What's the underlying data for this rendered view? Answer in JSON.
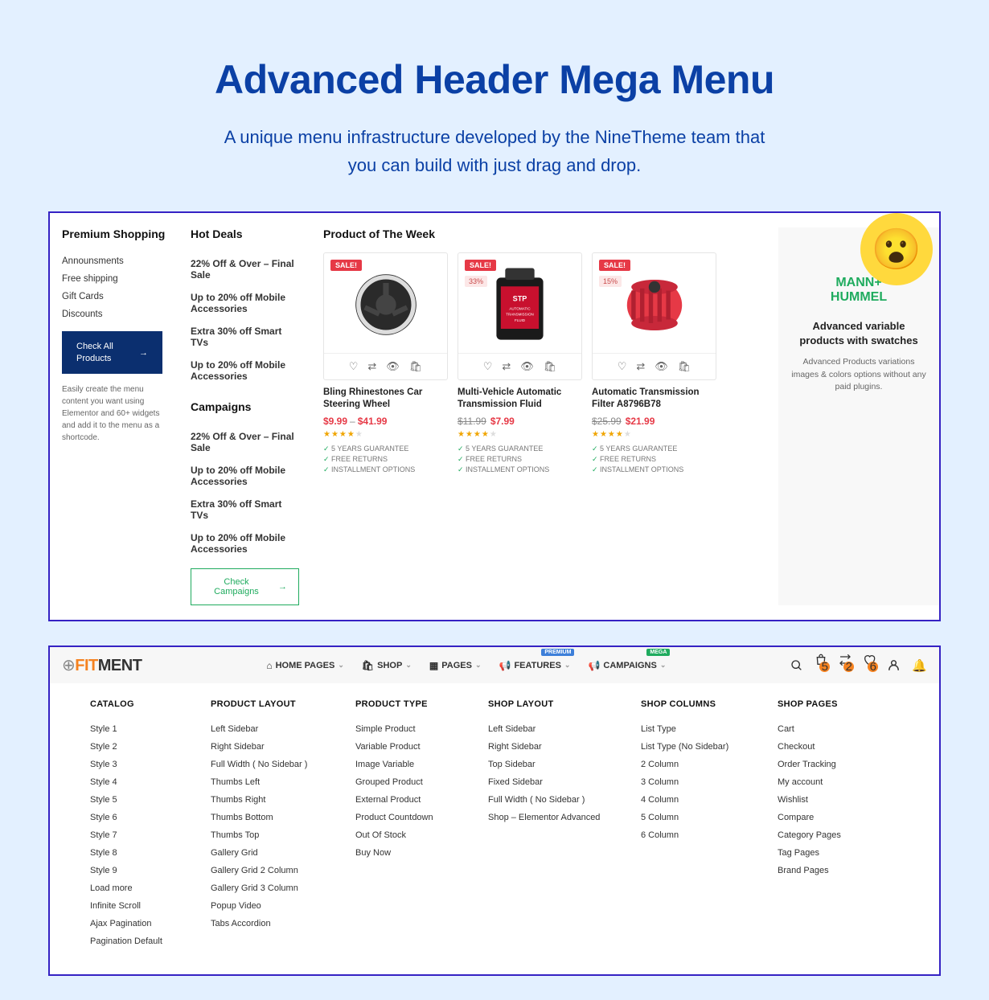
{
  "hero": {
    "title": "Advanced Header Mega Menu",
    "subtitle": "A unique menu infrastructure developed by the NineTheme team that you can build with just drag and drop."
  },
  "panel1": {
    "premium": {
      "heading": "Premium Shopping",
      "items": [
        "Announsments",
        "Free shipping",
        "Gift Cards",
        "Discounts"
      ],
      "button": "Check All Products",
      "helper": "Easily create the menu content you want using Elementor and 60+ widgets and add it to the menu as a shortcode."
    },
    "deals": {
      "heading": "Hot Deals",
      "items": [
        "22% Off & Over – Final Sale",
        "Up to 20% off Mobile Accessories",
        "Extra 30% off Smart TVs",
        "Up to 20% off Mobile Accessories"
      ],
      "campaigns_heading": "Campaigns",
      "campaign_items": [
        "22% Off & Over – Final Sale",
        "Up to 20% off Mobile Accessories",
        "Extra 30% off Smart TVs",
        "Up to 20% off Mobile Accessories"
      ],
      "button": "Check Campaigns"
    },
    "products_heading": "Product of The Week",
    "products": [
      {
        "sale": "SALE!",
        "pct": "",
        "title": "Bling Rhinestones Car Steering Wheel",
        "price_from": "$9.99",
        "price_to": "$41.99",
        "dash": true,
        "features": [
          "5 YEARS GUARANTEE",
          "FREE RETURNS",
          "INSTALLMENT OPTIONS"
        ]
      },
      {
        "sale": "SALE!",
        "pct": "33%",
        "title": "Multi-Vehicle Automatic Transmission Fluid",
        "price_old": "$11.99",
        "price_new": "$7.99",
        "features": [
          "5 YEARS GUARANTEE",
          "FREE RETURNS",
          "INSTALLMENT OPTIONS"
        ]
      },
      {
        "sale": "SALE!",
        "pct": "15%",
        "title": "Automatic Transmission Filter A8796B78",
        "price_old": "$25.99",
        "price_new": "$21.99",
        "features": [
          "5 YEARS GUARANTEE",
          "FREE RETURNS",
          "INSTALLMENT OPTIONS"
        ]
      }
    ],
    "brand": {
      "logo1": "MANN+",
      "logo2": "HUMMEL",
      "heading": "Advanced variable products with swatches",
      "desc": "Advanced Products variations images & colors options without any paid plugins."
    }
  },
  "panel2": {
    "logo_fit": "FIT",
    "logo_ment": "MENT",
    "nav": [
      {
        "label": "HOME PAGES",
        "tag": ""
      },
      {
        "label": "SHOP",
        "tag": ""
      },
      {
        "label": "PAGES",
        "tag": ""
      },
      {
        "label": "FEATURES",
        "tag": "PREMIUM"
      },
      {
        "label": "CAMPAIGNS",
        "tag": "MEGA"
      }
    ],
    "badges": {
      "bag": "5",
      "compare": "2",
      "heart": "6"
    },
    "cols": [
      {
        "heading": "CATALOG",
        "items": [
          "Style 1",
          "Style 2",
          "Style 3",
          "Style 4",
          "Style 5",
          "Style 6",
          "Style 7",
          "Style 8",
          "Style 9",
          "Load more",
          "Infinite Scroll",
          "Ajax Pagination",
          "Pagination Default"
        ]
      },
      {
        "heading": "PRODUCT LAYOUT",
        "items": [
          "Left Sidebar",
          "Right Sidebar",
          "Full Width ( No Sidebar )",
          "Thumbs Left",
          "Thumbs Right",
          "Thumbs Bottom",
          "Thumbs Top",
          "Gallery Grid",
          "Gallery Grid 2 Column",
          "Gallery Grid 3 Column",
          "Popup Video",
          "Tabs Accordion"
        ]
      },
      {
        "heading": "PRODUCT TYPE",
        "items": [
          "Simple Product",
          "Variable Product",
          "Image Variable",
          "Grouped Product",
          "External Product",
          "Product Countdown",
          "Out Of Stock",
          "Buy Now"
        ]
      },
      {
        "heading": "SHOP LAYOUT",
        "items": [
          "Left Sidebar",
          "Right Sidebar",
          "Top Sidebar",
          "Fixed Sidebar",
          "Full Width ( No Sidebar )",
          "Shop – Elementor Advanced"
        ]
      },
      {
        "heading": "SHOP COLUMNS",
        "items": [
          "List Type",
          "List Type (No Sidebar)",
          "2 Column",
          "3 Column",
          "4 Column",
          "5 Column",
          "6 Column"
        ]
      },
      {
        "heading": "SHOP PAGES",
        "items": [
          "Cart",
          "Checkout",
          "Order Tracking",
          "My account",
          "Wishlist",
          "Compare",
          "Category Pages",
          "Tag Pages",
          "Brand Pages"
        ]
      }
    ]
  }
}
